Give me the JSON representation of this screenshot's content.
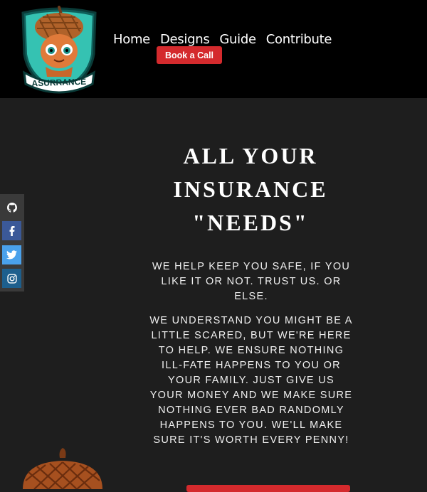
{
  "header": {
    "logo_text": "ASURRANCE",
    "nav": [
      {
        "label": "Home"
      },
      {
        "label": "Designs"
      },
      {
        "label": "Guide"
      },
      {
        "label": "Contribute"
      }
    ],
    "book_button": "Book a Call"
  },
  "social": {
    "icons": [
      "github-icon",
      "facebook-icon",
      "twitter-icon",
      "instagram-icon"
    ]
  },
  "hero": {
    "title": "ALL YOUR INSURANCE \"NEEDS\"",
    "paragraph1": "WE HELP KEEP YOU SAFE, IF YOU LIKE IT OR NOT. TRUST US. OR ELSE.",
    "paragraph2": "WE UNDERSTAND YOU MIGHT BE A LITTLE SCARED, BUT WE'RE HERE TO HELP. WE ENSURE NOTHING ILL-FATE HAPPENS TO YOU OR YOUR FAMILY. JUST GIVE US YOUR MONEY AND WE MAKE SURE NOTHING EVER BAD RANDOMLY HAPPENS TO YOU. WE'LL MAKE SURE IT'S WORTH EVERY PENNY!"
  },
  "colors": {
    "header_bg": "#000000",
    "page_bg": "#1e1e1e",
    "accent_red": "#d42a2d",
    "logo_teal": "#2fb3a6"
  }
}
